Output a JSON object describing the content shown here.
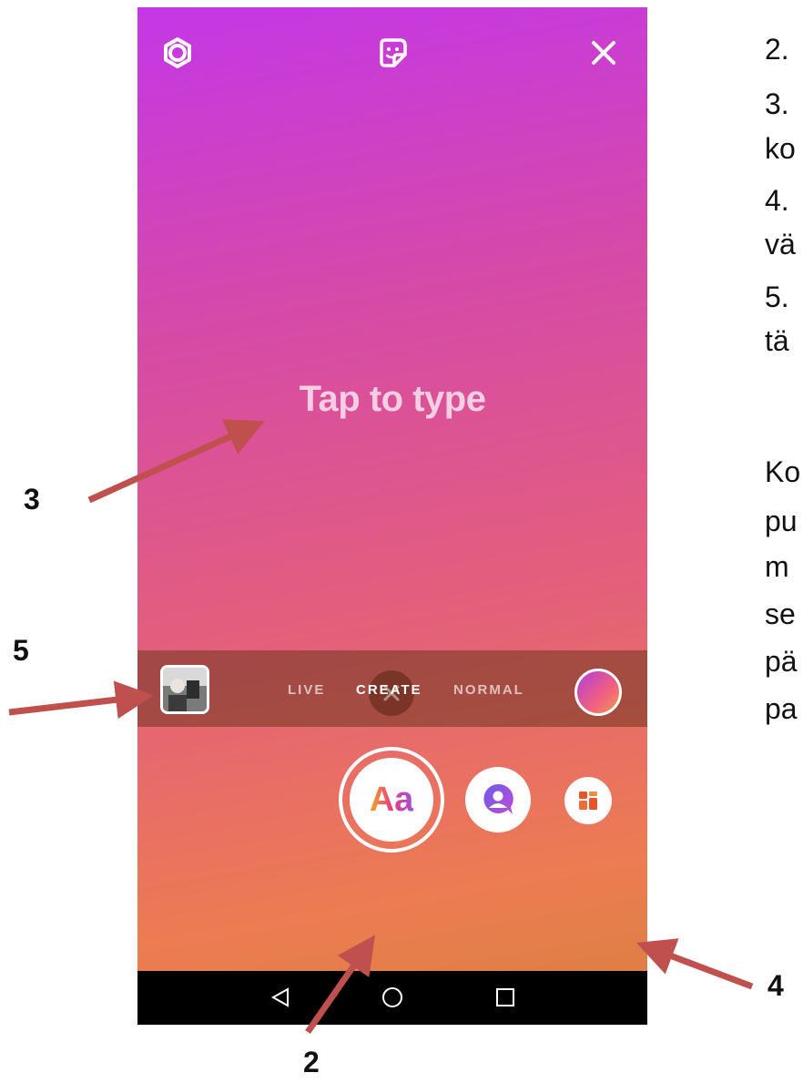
{
  "screen": {
    "tap_to_type": "Tap to type",
    "aa_label": "Aa",
    "modes": [
      "LIVE",
      "CREATE",
      "NORMAL"
    ]
  },
  "icons": {
    "settings": "settings-icon",
    "sticker": "sticker-icon",
    "close": "close-icon",
    "dismiss": "close-icon",
    "nav_back": "back-triangle-icon",
    "nav_home": "home-circle-icon",
    "nav_recents": "recents-square-icon"
  },
  "callouts": {
    "c2": "2",
    "c3": "3",
    "c4": "4",
    "c5": "5"
  },
  "side_text": {
    "lines": [
      "2.",
      "3.",
      "ko",
      "4.",
      "vä",
      "5.",
      "tä",
      "Ko",
      "pu",
      "m",
      "se",
      "pä",
      "pa"
    ]
  },
  "colors": {
    "gradient_top": "#c437e6",
    "gradient_bottom": "#ec7c52",
    "arrow": "#c0504d"
  }
}
